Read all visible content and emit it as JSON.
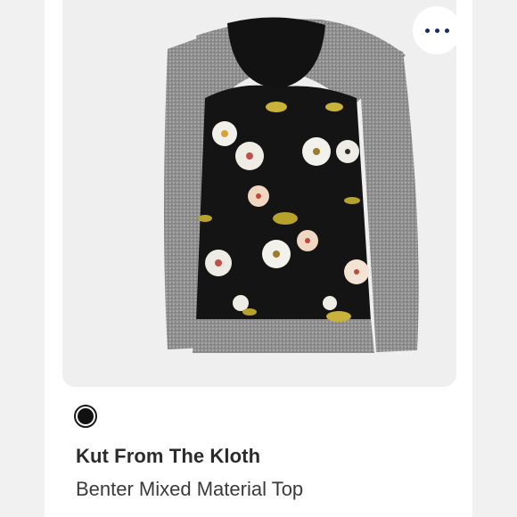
{
  "product": {
    "brand": "Kut From The Kloth",
    "name": "Benter Mixed Material Top",
    "image_icon": "floral-sweater-image",
    "swatch_color": "#111111"
  },
  "actions": {
    "more_icon": "more-horizontal-icon",
    "dot_color": "#1b2a6b"
  }
}
